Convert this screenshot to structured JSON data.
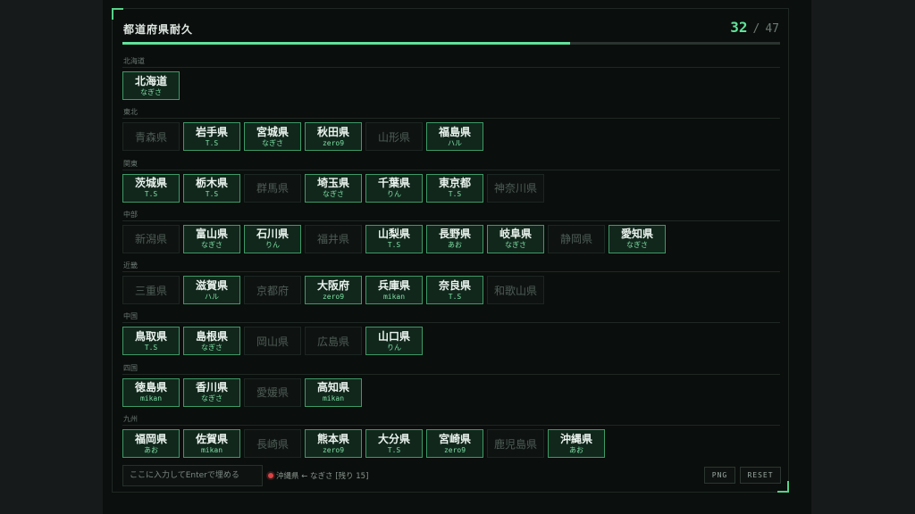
{
  "header": {
    "title": "都道府県耐久",
    "solved": "32",
    "separator": "/",
    "total": "47"
  },
  "progress": {
    "fraction": 0.681
  },
  "regions": [
    {
      "name": "北海道",
      "prefectures": [
        {
          "name": "北海道",
          "by": "なぎさ"
        }
      ]
    },
    {
      "name": "東北",
      "prefectures": [
        {
          "name": "青森県",
          "by": ""
        },
        {
          "name": "岩手県",
          "by": "T.S"
        },
        {
          "name": "宮城県",
          "by": "なぎさ"
        },
        {
          "name": "秋田県",
          "by": "zero9"
        },
        {
          "name": "山形県",
          "by": ""
        },
        {
          "name": "福島県",
          "by": "ハル"
        }
      ]
    },
    {
      "name": "関東",
      "prefectures": [
        {
          "name": "茨城県",
          "by": "T.S"
        },
        {
          "name": "栃木県",
          "by": "T.S"
        },
        {
          "name": "群馬県",
          "by": ""
        },
        {
          "name": "埼玉県",
          "by": "なぎさ"
        },
        {
          "name": "千葉県",
          "by": "りん"
        },
        {
          "name": "東京都",
          "by": "T.S"
        },
        {
          "name": "神奈川県",
          "by": ""
        }
      ]
    },
    {
      "name": "中部",
      "prefectures": [
        {
          "name": "新潟県",
          "by": ""
        },
        {
          "name": "富山県",
          "by": "なぎさ"
        },
        {
          "name": "石川県",
          "by": "りん"
        },
        {
          "name": "福井県",
          "by": ""
        },
        {
          "name": "山梨県",
          "by": "T.S"
        },
        {
          "name": "長野県",
          "by": "あお"
        },
        {
          "name": "岐阜県",
          "by": "なぎさ"
        },
        {
          "name": "静岡県",
          "by": ""
        },
        {
          "name": "愛知県",
          "by": "なぎさ"
        }
      ]
    },
    {
      "name": "近畿",
      "prefectures": [
        {
          "name": "三重県",
          "by": ""
        },
        {
          "name": "滋賀県",
          "by": "ハル"
        },
        {
          "name": "京都府",
          "by": ""
        },
        {
          "name": "大阪府",
          "by": "zero9"
        },
        {
          "name": "兵庫県",
          "by": "mikan"
        },
        {
          "name": "奈良県",
          "by": "T.S"
        },
        {
          "name": "和歌山県",
          "by": ""
        }
      ]
    },
    {
      "name": "中国",
      "prefectures": [
        {
          "name": "鳥取県",
          "by": "T.S"
        },
        {
          "name": "島根県",
          "by": "なぎさ"
        },
        {
          "name": "岡山県",
          "by": ""
        },
        {
          "name": "広島県",
          "by": ""
        },
        {
          "name": "山口県",
          "by": "りん"
        }
      ]
    },
    {
      "name": "四国",
      "prefectures": [
        {
          "name": "徳島県",
          "by": "mikan"
        },
        {
          "name": "香川県",
          "by": "なぎさ"
        },
        {
          "name": "愛媛県",
          "by": ""
        },
        {
          "name": "高知県",
          "by": "mikan"
        }
      ]
    },
    {
      "name": "九州",
      "prefectures": [
        {
          "name": "福岡県",
          "by": "あお"
        },
        {
          "name": "佐賀県",
          "by": "mikan"
        },
        {
          "name": "長崎県",
          "by": ""
        },
        {
          "name": "熊本県",
          "by": "zero9"
        },
        {
          "name": "大分県",
          "by": "T.S"
        },
        {
          "name": "宮崎県",
          "by": "zero9"
        },
        {
          "name": "鹿児島県",
          "by": ""
        },
        {
          "name": "沖縄県",
          "by": "あお"
        }
      ]
    }
  ],
  "footer": {
    "input_placeholder": "ここに入力してEnterで埋める",
    "input_value": "",
    "log_text": "沖縄県 ← なぎさ [残り 15]",
    "png_label": "PNG",
    "reset_label": "RESET"
  },
  "colors": {
    "accent": "#5fe39a",
    "solved_border": "#3e9a66",
    "solved_bg": "#11271c",
    "log_dot": "#d94444"
  }
}
